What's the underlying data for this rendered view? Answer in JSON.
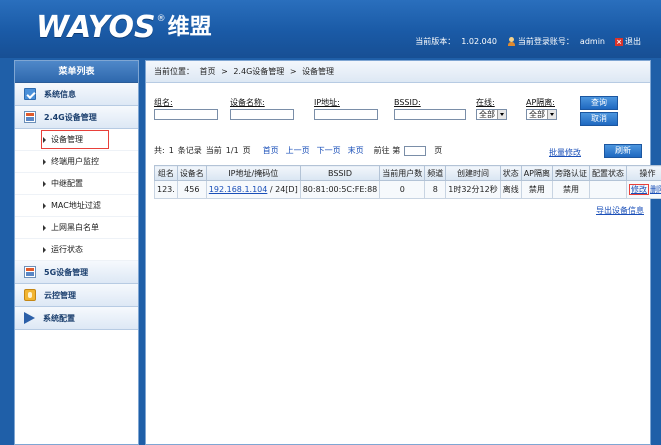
{
  "header": {
    "logo_text": "WAYOS",
    "logo_reg": "®",
    "logo_cn": "维盟",
    "version_label": "当前版本：",
    "version_value": "1.02.040",
    "account_label": "当前登录账号：",
    "account_value": "admin",
    "logout_label": "退出"
  },
  "sidebar": {
    "title": "菜单列表",
    "groups": [
      {
        "label": "系统信息",
        "icon": "system-info-icon"
      },
      {
        "label": "2.4G设备管理",
        "icon": "wireless-device-icon"
      },
      {
        "label": "5G设备管理",
        "icon": "wireless-device-icon"
      },
      {
        "label": "云控管理",
        "icon": "cloud-control-icon"
      },
      {
        "label": "系统配置",
        "icon": "flag-icon"
      }
    ],
    "sub_items": [
      "设备管理",
      "终端用户监控",
      "中继配置",
      "MAC地址过滤",
      "上网黑白名单",
      "运行状态"
    ]
  },
  "breadcrumb": {
    "prefix": "当前位置：",
    "home": "首页",
    "sep": ">",
    "level1": "2.4G设备管理",
    "level2": "设备管理"
  },
  "filters": {
    "group_label": "组名:",
    "device_name_label": "设备名称:",
    "ip_label": "IP地址:",
    "bssid_label": "BSSID:",
    "online_label": "在线:",
    "online_value": "全部",
    "ap_isolation_label": "AP隔离:",
    "ap_isolation_value": "全部",
    "query_button": "查询",
    "cancel_button": "取消"
  },
  "pager": {
    "total_prefix": "共:",
    "total": "1",
    "total_suffix": "条记录",
    "current_prefix": "当前",
    "current": "1/1",
    "current_suffix": "页",
    "first": "首页",
    "prev": "上一页",
    "next": "下一页",
    "last": "末页",
    "goto_prefix": "前往 第",
    "goto_suffix": "页",
    "bulk_edit": "批量修改",
    "refresh": "刷新"
  },
  "table": {
    "headers": [
      "组名",
      "设备名",
      "IP地址/掩码位",
      "BSSID",
      "当前用户数",
      "频道",
      "创建时间",
      "状态",
      "AP隔离",
      "旁路认证",
      "配置状态",
      "操作"
    ],
    "rows": [
      {
        "group": "123.",
        "device": "456",
        "ip": "192.168.1.104",
        "mask": " / 24[D]",
        "bssid": "80:81:00:5C:FE:88",
        "users": "0",
        "channel": "8",
        "created": "1时32分12秒",
        "status": "离线",
        "ap_isolation": "禁用",
        "bypass_auth": "禁用",
        "config_status": "",
        "op_edit": "修改",
        "op_delete": "删除"
      }
    ],
    "export": "导出设备信息"
  }
}
